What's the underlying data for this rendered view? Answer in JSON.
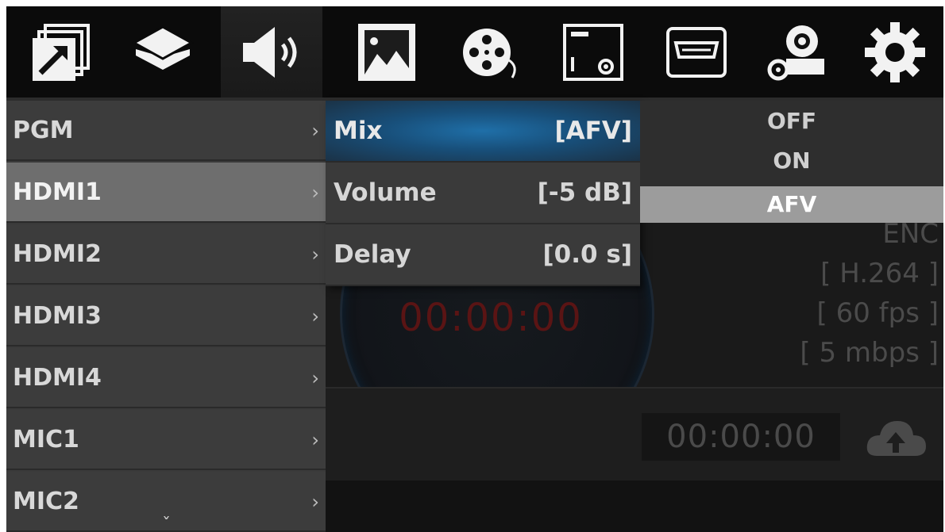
{
  "toolbar": {
    "icons": [
      {
        "name": "output-icon",
        "active": false
      },
      {
        "name": "layers-icon",
        "active": false
      },
      {
        "name": "audio-icon",
        "active": true
      },
      {
        "name": "image-icon",
        "active": false
      },
      {
        "name": "film-reel-icon",
        "active": false
      },
      {
        "name": "overlay-settings-icon",
        "active": false
      },
      {
        "name": "hdmi-icon",
        "active": false
      },
      {
        "name": "camera-settings-icon",
        "active": false
      },
      {
        "name": "gear-icon",
        "active": false
      }
    ]
  },
  "channels": {
    "items": [
      {
        "label": "PGM",
        "chevron": "›"
      },
      {
        "label": "HDMI1",
        "chevron": "›"
      },
      {
        "label": "HDMI2",
        "chevron": "›"
      },
      {
        "label": "HDMI3",
        "chevron": "›"
      },
      {
        "label": "HDMI4",
        "chevron": "›"
      },
      {
        "label": "MIC1",
        "chevron": "›"
      },
      {
        "label": "MIC2",
        "chevron": "›"
      }
    ],
    "selected": "HDMI1",
    "more_indicator": "ˇ"
  },
  "submenu": {
    "items": [
      {
        "label": "Mix",
        "value": "[AFV]"
      },
      {
        "label": "Volume",
        "value": "[-5 dB]"
      },
      {
        "label": "Delay",
        "value": "[0.0 s]"
      }
    ],
    "highlighted": "Mix"
  },
  "options": {
    "items": [
      "OFF",
      "ON",
      "AFV"
    ],
    "selected": "AFV"
  },
  "status": {
    "record_timer": "00:00:00",
    "enc_label": "ENC",
    "codec": "[ H.264 ]",
    "fps": "[ 60 fps ]",
    "bitrate": "[ 5 mbps ]",
    "stream_timer": "00:00:00"
  },
  "colors": {
    "accent_blue": "#1f6fa8",
    "timer_red": "#5a1414",
    "icon_white": "#f2f2f2"
  }
}
